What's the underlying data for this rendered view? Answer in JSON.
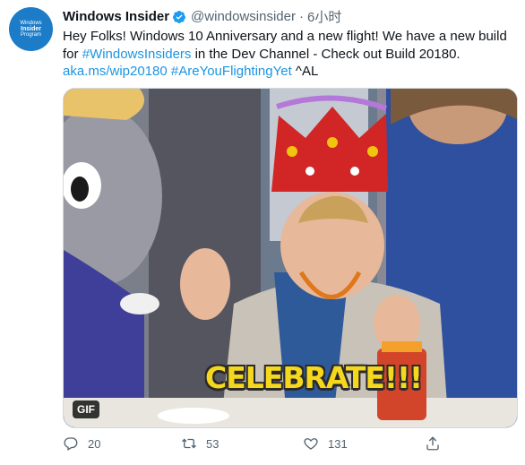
{
  "account": {
    "avatar_line1": "Windows",
    "avatar_line2": "Insider",
    "avatar_line3": "Program",
    "display_name": "Windows Insider",
    "handle": "@windowsinsider",
    "separator": "·",
    "time": "6小时"
  },
  "tweet": {
    "text_1": "Hey Folks! Windows 10 Anniversary and a new flight! We have a new build for ",
    "hashtag_1": "#WindowsInsiders",
    "text_2": " in the Dev Channel - Check out Build 20180. ",
    "link": "aka.ms/wip20180",
    "text_3": " ",
    "hashtag_2": "#AreYouFlightingYet",
    "text_4": " ^AL"
  },
  "media": {
    "badge": "GIF",
    "caption": "CELEBRATE!!!"
  },
  "actions": {
    "reply_count": "20",
    "retweet_count": "53",
    "like_count": "131"
  },
  "icons": {
    "reply": "reply-icon",
    "retweet": "retweet-icon",
    "like": "heart-icon",
    "share": "share-icon",
    "verified": "verified-badge-icon"
  },
  "colors": {
    "link": "#1b95e0",
    "verified": "#1d9bf0",
    "avatar_bg": "#1d7cc8",
    "muted": "#536471"
  }
}
